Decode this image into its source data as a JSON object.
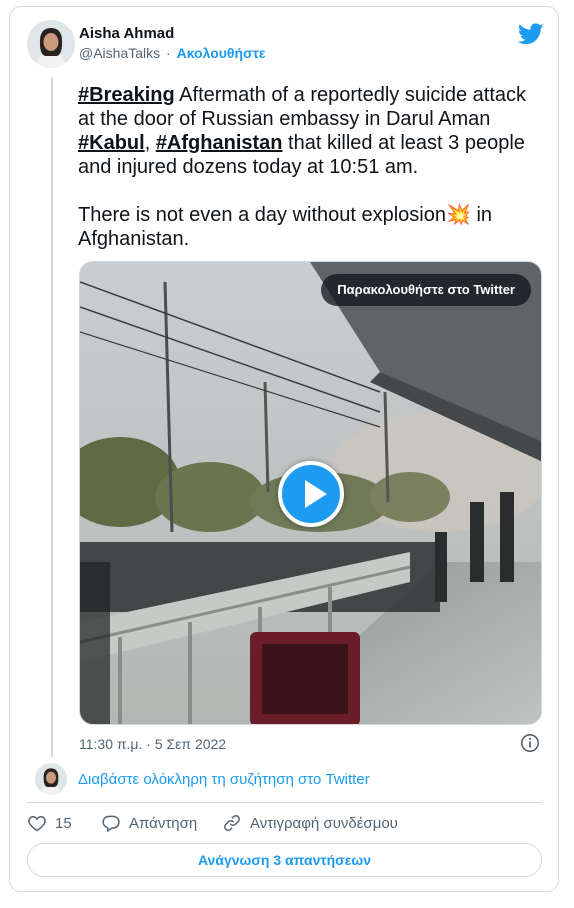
{
  "author": {
    "name": "Aisha Ahmad",
    "handle": "@AishaTalks",
    "separator": "·",
    "follow_label": "Ακολουθήστε"
  },
  "tweet": {
    "line1_hashtag": "#Breaking",
    "line1_text": " Aftermath of a reportedly suicide attack at the door of Russian embassy in Darul Aman ",
    "hashtag_kabul": "#Kabul",
    "comma": ", ",
    "hashtag_afghanistan": "#Afghanistan",
    "line1_tail": " that killed at least 3 people and injured dozens today at 10:51 am.",
    "line2_text": "There is not even a day without explosion",
    "line2_emoji": "💥",
    "line2_tail": " in Afghanistan."
  },
  "media": {
    "watch_label": "Παρακολουθήστε στο Twitter"
  },
  "timestamp": "11:30 π.μ. · 5 Σεπ 2022",
  "read_conversation": "Διαβάστε ολόκληρη τη συζήτηση στο Twitter",
  "actions": {
    "likes": "15",
    "reply_label": "Απάντηση",
    "copy_label": "Αντιγραφή συνδέσμου"
  },
  "read_replies": "Ανάγνωση 3 απαντήσεων",
  "colors": {
    "accent": "#1d9bf0",
    "text": "#0f1419",
    "secondary": "#536471",
    "border": "#cfd9de"
  }
}
